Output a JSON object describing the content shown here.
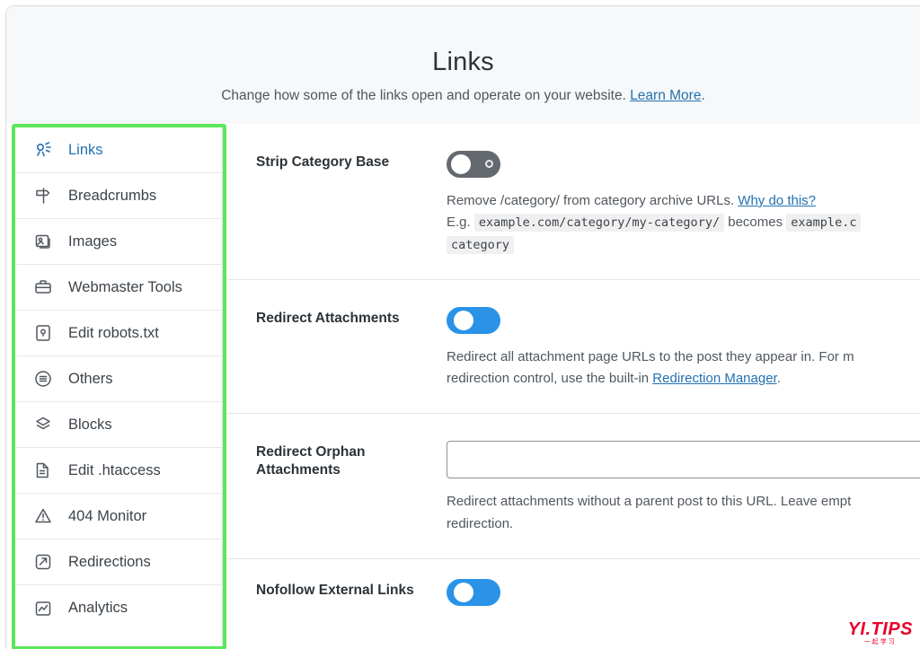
{
  "header": {
    "title": "Links",
    "subtitle_before": "Change how some of the links open and operate on your website. ",
    "learn_more": "Learn More",
    "subtitle_after": "."
  },
  "sidebar": {
    "items": [
      {
        "label": "Links",
        "icon": "links-icon",
        "active": true
      },
      {
        "label": "Breadcrumbs",
        "icon": "breadcrumbs-icon",
        "active": false
      },
      {
        "label": "Images",
        "icon": "images-icon",
        "active": false
      },
      {
        "label": "Webmaster Tools",
        "icon": "toolbox-icon",
        "active": false
      },
      {
        "label": "Edit robots.txt",
        "icon": "robots-file-icon",
        "active": false
      },
      {
        "label": "Others",
        "icon": "list-circle-icon",
        "active": false
      },
      {
        "label": "Blocks",
        "icon": "blocks-icon",
        "active": false
      },
      {
        "label": "Edit .htaccess",
        "icon": "document-icon",
        "active": false
      },
      {
        "label": "404 Monitor",
        "icon": "warning-triangle-icon",
        "active": false
      },
      {
        "label": "Redirections",
        "icon": "redirect-arrow-icon",
        "active": false
      },
      {
        "label": "Analytics",
        "icon": "analytics-chart-icon",
        "active": false
      }
    ]
  },
  "settings": {
    "strip_category_base": {
      "label": "Strip Category Base",
      "toggle_state": "off",
      "help_before": "Remove /category/ from category archive URLs. ",
      "help_link": "Why do this?",
      "example_prefix": "E.g.",
      "example_code_1": "example.com/category/my-category/",
      "example_middle": "becomes",
      "example_code_2": "example.c",
      "example_code_3": "category"
    },
    "redirect_attachments": {
      "label": "Redirect Attachments",
      "toggle_state": "on",
      "help_line_1_before": "Redirect all attachment page URLs to the post they appear in. For m",
      "help_line_2_before": "redirection control, use the built-in ",
      "help_link": "Redirection Manager",
      "help_line_2_after": "."
    },
    "redirect_orphan_attachments": {
      "label": "Redirect Orphan Attachments",
      "input_value": "",
      "input_placeholder": "",
      "help_line_1": "Redirect attachments without a parent post to this URL. Leave empt",
      "help_line_2": "redirection."
    },
    "nofollow_external_links": {
      "label": "Nofollow External Links",
      "toggle_state": "on"
    }
  },
  "watermark": {
    "main": "YI.TIPS",
    "sub": "一起学习"
  }
}
